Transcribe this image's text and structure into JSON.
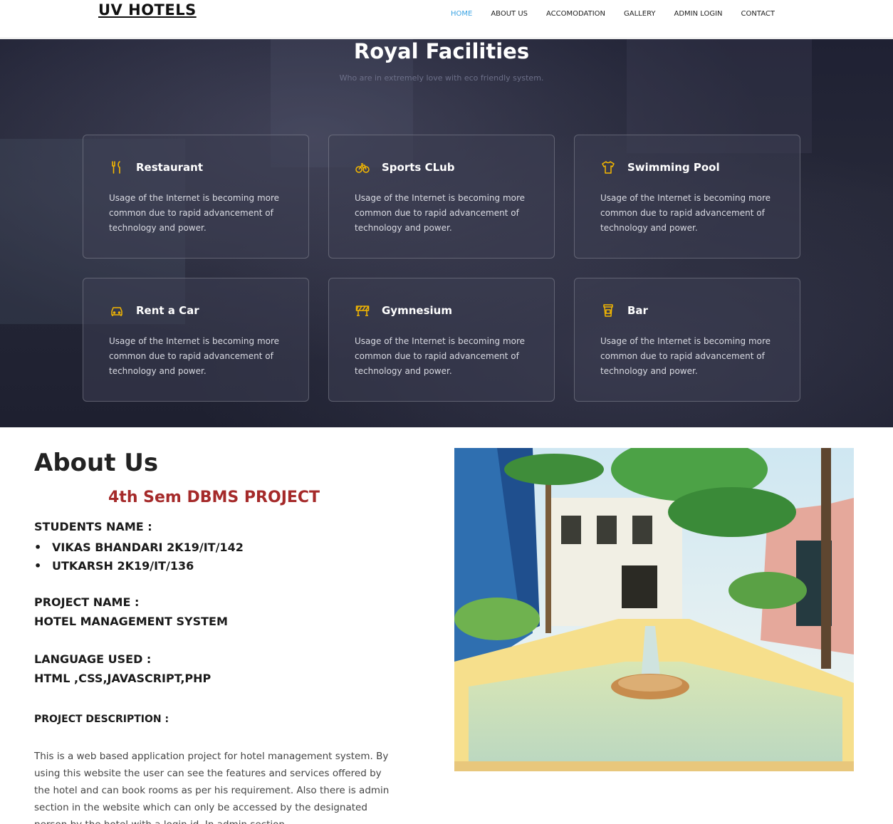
{
  "header": {
    "logo": "UV HOTELS",
    "nav": [
      {
        "label": "HOME",
        "active": true
      },
      {
        "label": "ABOUT US"
      },
      {
        "label": "ACCOMODATION"
      },
      {
        "label": "GALLERY"
      },
      {
        "label": "ADMIN LOGIN"
      },
      {
        "label": "CONTACT"
      }
    ]
  },
  "facilities": {
    "title": "Royal Facilities",
    "subtitle": "Who are in extremely love with eco friendly system.",
    "accent": "#f5b800",
    "cards": [
      {
        "icon": "restaurant-icon",
        "title": "Restaurant",
        "text": "Usage of the Internet is becoming more common due to rapid advancement of technology and power."
      },
      {
        "icon": "bicycle-icon",
        "title": "Sports CLub",
        "text": "Usage of the Internet is becoming more common due to rapid advancement of technology and power."
      },
      {
        "icon": "shirt-icon",
        "title": "Swimming Pool",
        "text": "Usage of the Internet is becoming more common due to rapid advancement of technology and power."
      },
      {
        "icon": "car-icon",
        "title": "Rent a Car",
        "text": "Usage of the Internet is becoming more common due to rapid advancement of technology and power."
      },
      {
        "icon": "construction-icon",
        "title": "Gymnesium",
        "text": "Usage of the Internet is becoming more common due to rapid advancement of technology and power."
      },
      {
        "icon": "cup-icon",
        "title": "Bar",
        "text": "Usage of the Internet is becoming more common due to rapid advancement of technology and power."
      }
    ]
  },
  "about": {
    "title": "About Us",
    "project_heading": "4th Sem DBMS PROJECT",
    "project_heading_color": "#a52a2a",
    "students_label": "STUDENTS NAME :",
    "students": [
      "VIKAS BHANDARI 2K19/IT/142",
      "UTKARSH 2K19/IT/136"
    ],
    "project_name_label": "PROJECT NAME :",
    "project_name": "HOTEL MANAGEMENT SYSTEM",
    "language_label": "LANGUAGE USED :",
    "language": "HTML ,CSS,JAVASCRIPT,PHP",
    "description_label": "PROJECT DESCRIPTION :",
    "description": "This is a web based application project for hotel management system. By using this website the user can see the features and services offered by the hotel and can book rooms as per his requirement. Also there is admin section in the website which can only be accessed by the designated person by the hotel with a login id. In admin section"
  }
}
